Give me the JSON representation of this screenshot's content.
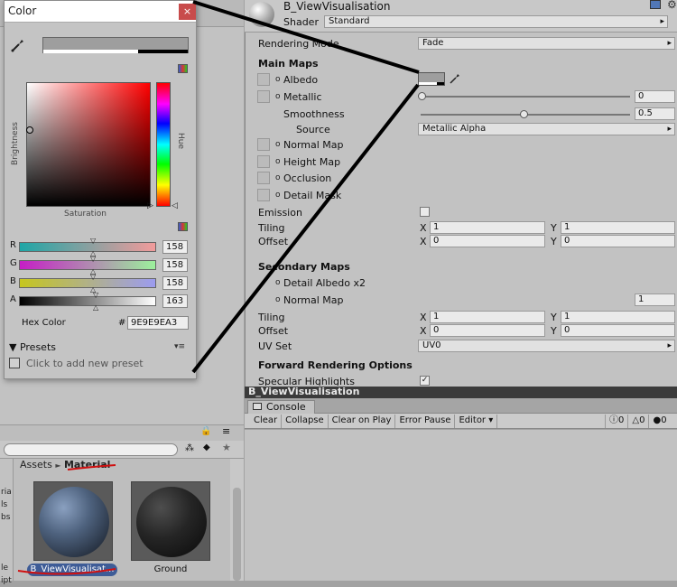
{
  "color_picker": {
    "title": "Color",
    "close_label": "×",
    "brightness_label": "Brightness",
    "hue_label": "Hue",
    "saturation_label": "Saturation",
    "channels": [
      {
        "label": "R",
        "value": "158",
        "gradient": "linear-gradient(90deg,#1ea6a6,#f29b9b)"
      },
      {
        "label": "G",
        "value": "158",
        "gradient": "linear-gradient(90deg,#c61ec6,#9cf09c)"
      },
      {
        "label": "B",
        "value": "158",
        "gradient": "linear-gradient(90deg,#c6c61e,#9c9cf0)"
      },
      {
        "label": "A",
        "value": "163",
        "gradient": "linear-gradient(90deg,#000000,#ffffff)"
      }
    ],
    "hex_label": "Hex Color",
    "hex_hash": "#",
    "hex_value": "9E9E9EA3",
    "presets_label": "▼ Presets",
    "presets_menu": "▾≡",
    "preset_hint": "Click to add new preset"
  },
  "project": {
    "breadcrumb_root": "Assets",
    "breadcrumb_sep": "►",
    "breadcrumb_current": "Material",
    "assets": [
      {
        "name": "B_ViewVisualisat..."
      },
      {
        "name": "Ground"
      }
    ],
    "left_strip": "ria\nls\nbs\n\n\n\nle\nipt"
  },
  "inspector": {
    "material_name": "B_ViewVisualisation",
    "shader_label": "Shader",
    "shader_value": "Standard",
    "rendering_mode_label": "Rendering Mode",
    "rendering_mode_value": "Fade",
    "main_maps_label": "Main Maps",
    "albedo_label": "Albedo",
    "metallic_label": "Metallic",
    "metallic_value": "0",
    "smoothness_label": "Smoothness",
    "smoothness_value": "0.5",
    "source_label": "Source",
    "source_value": "Metallic Alpha",
    "normal_map_label": "Normal Map",
    "height_map_label": "Height Map",
    "occlusion_label": "Occlusion",
    "detail_mask_label": "Detail Mask",
    "emission_label": "Emission",
    "tiling_label": "Tiling",
    "offset_label": "Offset",
    "x_label": "X",
    "y_label": "Y",
    "main_tiling_x": "1",
    "main_tiling_y": "1",
    "main_offset_x": "0",
    "main_offset_y": "0",
    "secondary_maps_label": "Secondary Maps",
    "detail_albedo_label": "Detail Albedo x2",
    "secondary_normal_label": "Normal Map",
    "secondary_normal_value": "1",
    "sec_tiling_x": "1",
    "sec_tiling_y": "1",
    "sec_offset_x": "0",
    "sec_offset_y": "0",
    "uv_set_label": "UV Set",
    "uv_set_value": "UV0",
    "forward_label": "Forward Rendering Options",
    "specular_label": "Specular Highlights",
    "dot_glyph": "o",
    "dd_arrow": "▸"
  },
  "console": {
    "header_title": "B_ViewVisualisation",
    "tab_label": "Console",
    "buttons": {
      "clear": "Clear",
      "collapse": "Collapse",
      "clear_on_play": "Clear on Play",
      "error_pause": "Error Pause",
      "editor": "Editor ▾"
    },
    "info_count": "0",
    "warning_count": "0",
    "error_count": "0"
  },
  "colors": {
    "current_color": "#9E9E9E",
    "annotation_black": "#000000",
    "annotation_red": "#d01010",
    "selection_blue": "#3e5c97"
  }
}
